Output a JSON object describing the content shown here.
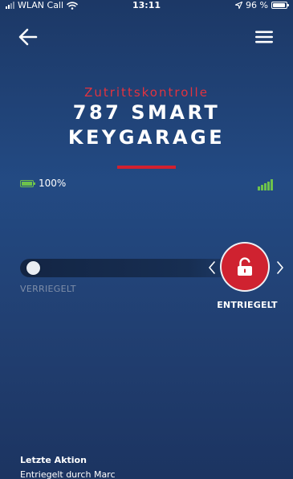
{
  "status_bar": {
    "carrier": "WLAN Call",
    "time": "13:11",
    "battery_percent": "96 %",
    "icons": [
      "cellular-signal-icon",
      "wifi-icon",
      "location-arrow-icon",
      "battery-icon"
    ]
  },
  "header": {
    "back_icon": "arrow-left-icon",
    "menu_icon": "hamburger-menu-icon"
  },
  "device": {
    "subtitle": "Zutrittskontrolle",
    "title_line1": "787 SMART",
    "title_line2": "KEYGARAGE",
    "battery_level": "100%",
    "signal_strength_bars": 5
  },
  "lock_slider": {
    "locked_label": "VERRIEGELT",
    "unlocked_label": "ENTRIEGELT",
    "state": "unlocked",
    "button_icon": "unlocked-padlock-icon"
  },
  "last_action": {
    "title": "Letzte Aktion",
    "text": "Entriegelt durch Marc"
  },
  "colors": {
    "background_top": "#1c3866",
    "background_mid": "#234a83",
    "accent_red": "#cf2230",
    "subtitle_red": "#e2333f",
    "battery_green": "#6dc24b",
    "muted_label": "#7f8ea8",
    "track": "#132544"
  }
}
